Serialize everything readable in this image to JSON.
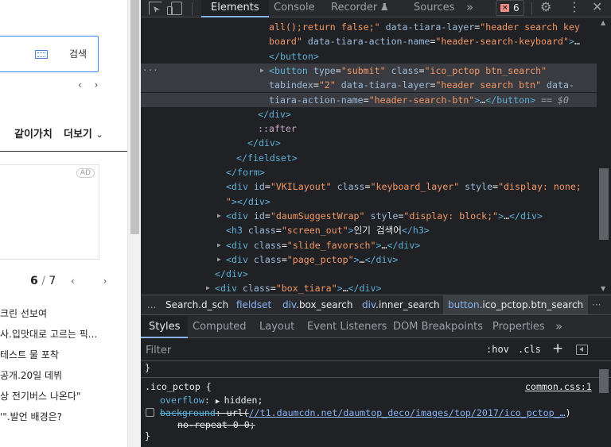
{
  "webpage": {
    "search_label": "검색",
    "nav_arrows": "‹ ›",
    "menu": [
      "같이가치",
      "더보기"
    ],
    "ad_badge": "AD",
    "pager": {
      "current": "6",
      "sep": " / ",
      "total": "7"
    },
    "pager_arrows": "‹ ›",
    "news": [
      "크린 선보여",
      "사.입맛대로 고르는 픽...",
      "테스트 물 포착",
      "공개.20일 데뷔",
      "상 전기버스 나온다\"",
      "'\".발언 배경은?"
    ]
  },
  "devtools": {
    "tabs": [
      "Elements",
      "Console",
      "Recorder",
      "Sources"
    ],
    "more_tabs": "»",
    "issues_count": "6",
    "gear": "⚙",
    "kebab": "⋮",
    "close": "✕",
    "dom": [
      {
        "indent": 338,
        "parts": [
          [
            "val",
            "all();return false;\""
          ],
          [
            "attr",
            " data-tiara-layer"
          ],
          [
            "txt",
            "="
          ],
          [
            "val",
            "\"header search key"
          ]
        ]
      },
      {
        "indent": 338,
        "parts": [
          [
            "val",
            "board\""
          ],
          [
            "attr",
            " data-tiara-action-name"
          ],
          [
            "txt",
            "="
          ],
          [
            "val",
            "\"header-search-keyboard\""
          ],
          [
            "tag",
            ">"
          ],
          [
            "txt",
            "…"
          ]
        ]
      },
      {
        "indent": 338,
        "parts": [
          [
            "tag",
            "</button>"
          ]
        ]
      },
      {
        "indent": 338,
        "selected": true,
        "gutter": "···",
        "tri": "▶",
        "parts": [
          [
            "tag",
            "<button"
          ],
          [
            "attr",
            " type"
          ],
          [
            "txt",
            "="
          ],
          [
            "val",
            "\"submit\""
          ],
          [
            "attr",
            " class"
          ],
          [
            "txt",
            "="
          ],
          [
            "val",
            "\"ico_pctop btn_search\""
          ]
        ]
      },
      {
        "indent": 338,
        "selected": true,
        "parts": [
          [
            "attr",
            "tabindex"
          ],
          [
            "txt",
            "="
          ],
          [
            "val",
            "\"2\""
          ],
          [
            "attr",
            " data-tiara-layer"
          ],
          [
            "txt",
            "="
          ],
          [
            "val",
            "\"header search btn\""
          ],
          [
            "attr",
            " data-"
          ]
        ]
      },
      {
        "indent": 338,
        "selected": true,
        "parts": [
          [
            "attr",
            "tiara-action-name"
          ],
          [
            "txt",
            "="
          ],
          [
            "val",
            "\"header-search-btn\""
          ],
          [
            "tag",
            ">"
          ],
          [
            "txt",
            "…"
          ],
          [
            "tag",
            "</button>"
          ],
          [
            "dim",
            " == $0"
          ]
        ]
      },
      {
        "indent": 324,
        "parts": [
          [
            "tag",
            "</div>"
          ]
        ]
      },
      {
        "indent": 324,
        "parts": [
          [
            "pseudo",
            "::after"
          ]
        ]
      },
      {
        "indent": 311,
        "parts": [
          [
            "tag",
            "</div>"
          ]
        ]
      },
      {
        "indent": 297,
        "parts": [
          [
            "tag",
            "</fieldset>"
          ]
        ]
      },
      {
        "indent": 284,
        "parts": [
          [
            "tag",
            "</form>"
          ]
        ]
      },
      {
        "indent": 284,
        "parts": [
          [
            "tag",
            "<div"
          ],
          [
            "attr",
            " id"
          ],
          [
            "txt",
            "="
          ],
          [
            "val",
            "\"VKILayout\""
          ],
          [
            "attr",
            " class"
          ],
          [
            "txt",
            "="
          ],
          [
            "val",
            "\"keyboard_layer\""
          ],
          [
            "attr",
            " style"
          ],
          [
            "txt",
            "="
          ],
          [
            "val",
            "\"display: none;"
          ]
        ]
      },
      {
        "indent": 284,
        "parts": [
          [
            "val",
            "\""
          ],
          [
            "tag",
            ">"
          ],
          [
            "tag",
            "</div>"
          ]
        ]
      },
      {
        "indent": 284,
        "tri": "▶",
        "parts": [
          [
            "tag",
            "<div"
          ],
          [
            "attr",
            " id"
          ],
          [
            "txt",
            "="
          ],
          [
            "val",
            "\"daumSuggestWrap\""
          ],
          [
            "attr",
            " style"
          ],
          [
            "txt",
            "="
          ],
          [
            "val",
            "\"display: block;\""
          ],
          [
            "tag",
            ">"
          ],
          [
            "txt",
            "…"
          ],
          [
            "tag",
            "</div>"
          ]
        ]
      },
      {
        "indent": 284,
        "parts": [
          [
            "tag",
            "<h3"
          ],
          [
            "attr",
            " class"
          ],
          [
            "txt",
            "="
          ],
          [
            "val",
            "\"screen_out\""
          ],
          [
            "tag",
            ">"
          ],
          [
            "txt",
            "인기 검색어"
          ],
          [
            "tag",
            "</h3>"
          ]
        ]
      },
      {
        "indent": 284,
        "tri": "▶",
        "parts": [
          [
            "tag",
            "<div"
          ],
          [
            "attr",
            " class"
          ],
          [
            "txt",
            "="
          ],
          [
            "val",
            "\"slide_favorsch\""
          ],
          [
            "tag",
            ">"
          ],
          [
            "txt",
            "…"
          ],
          [
            "tag",
            "</div>"
          ]
        ]
      },
      {
        "indent": 284,
        "tri": "▶",
        "parts": [
          [
            "tag",
            "<div"
          ],
          [
            "attr",
            " class"
          ],
          [
            "txt",
            "="
          ],
          [
            "val",
            "\"page_pctop\""
          ],
          [
            "tag",
            ">"
          ],
          [
            "txt",
            "…"
          ],
          [
            "tag",
            "</div>"
          ]
        ]
      },
      {
        "indent": 270,
        "parts": [
          [
            "tag",
            "</div>"
          ]
        ]
      },
      {
        "indent": 270,
        "tri": "▶",
        "parts": [
          [
            "tag",
            "<div"
          ],
          [
            "attr",
            " class"
          ],
          [
            "txt",
            "="
          ],
          [
            "val",
            "\"box_tiara\""
          ],
          [
            "tag",
            ">"
          ],
          [
            "txt",
            "…"
          ],
          [
            "tag",
            "</div>"
          ]
        ]
      }
    ],
    "breadcrumbs": {
      "dots": "...",
      "items": [
        {
          "tag": "",
          "rest": "Search.d_sch",
          "plain": true
        },
        {
          "tag": "fieldset",
          "rest": ""
        },
        {
          "tag": "div",
          "rest": ".box_search"
        },
        {
          "tag": "div",
          "rest": ".inner_search"
        },
        {
          "tag": "button",
          "rest": ".ico_pctop.btn_search"
        }
      ],
      "more": "···"
    },
    "styles_tabs": [
      "Styles",
      "Computed",
      "Layout",
      "Event Listeners",
      "DOM Breakpoints",
      "Properties"
    ],
    "styles_more": "»",
    "filter_placeholder": "Filter",
    "hov": ":hov",
    "cls": ".cls",
    "plus": "+",
    "rule": {
      "prev_close": "}",
      "selector": ".ico_pctop {",
      "source": "common.css:1",
      "overflow_prop": "overflow",
      "overflow_val": "hidden",
      "bg_prop": "background",
      "bg_url_prefix": "url(",
      "bg_url": "//t1.daumcdn.net/daumtop_deco/images/top/2017/ico_pctop_…",
      "bg_url_suffix": ")",
      "bg_rest": "no-repeat 0 0;",
      "close": "}"
    }
  }
}
